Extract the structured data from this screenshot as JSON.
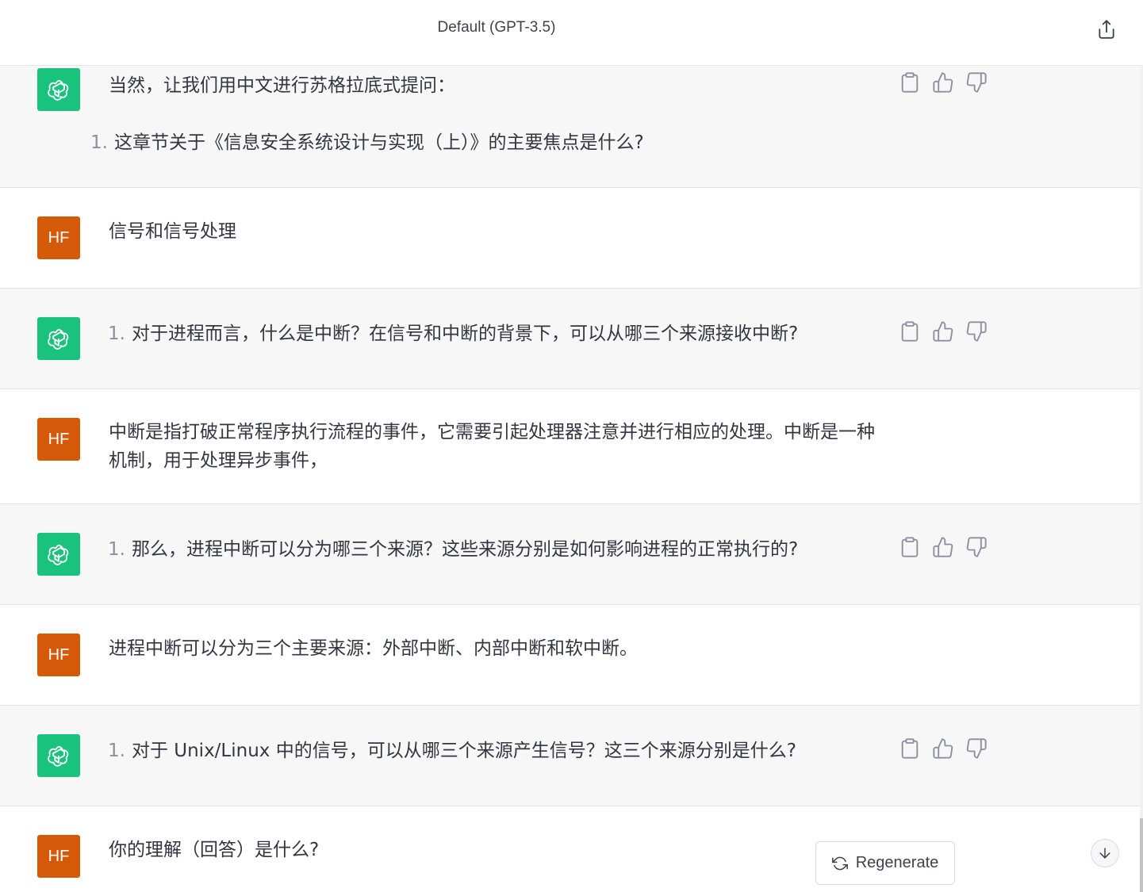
{
  "header": {
    "title": "Default (GPT-3.5)",
    "share_icon": "share-icon"
  },
  "messages": [
    {
      "role": "assistant",
      "avatar_icon": "openai-logo-icon",
      "intro": "当然，让我们用中文进行苏格拉底式提问：",
      "list": [
        {
          "num": "1.",
          "text": "这章节关于《信息安全系统设计与实现（上）》的主要焦点是什么?"
        }
      ]
    },
    {
      "role": "user",
      "avatar_label": "HF",
      "text": "信号和信号处理"
    },
    {
      "role": "assistant",
      "avatar_icon": "openai-logo-icon",
      "list": [
        {
          "num": "1.",
          "text": "对于进程而言，什么是中断？在信号和中断的背景下，可以从哪三个来源接收中断?"
        }
      ]
    },
    {
      "role": "user",
      "avatar_label": "HF",
      "text": "中断是指打破正常程序执行流程的事件，它需要引起处理器注意并进行相应的处理。中断是一种机制，用于处理异步事件，"
    },
    {
      "role": "assistant",
      "avatar_icon": "openai-logo-icon",
      "list": [
        {
          "num": "1.",
          "text": "那么，进程中断可以分为哪三个来源？这些来源分别是如何影响进程的正常执行的?"
        }
      ]
    },
    {
      "role": "user",
      "avatar_label": "HF",
      "text": "进程中断可以分为三个主要来源：外部中断、内部中断和软中断。"
    },
    {
      "role": "assistant",
      "avatar_icon": "openai-logo-icon",
      "list": [
        {
          "num": "1.",
          "text": "对于 Unix/Linux 中的信号，可以从哪三个来源产生信号？这三个来源分别是什么?"
        }
      ]
    },
    {
      "role": "user",
      "avatar_label": "HF",
      "text": "你的理解（回答）是什么?"
    }
  ],
  "message_actions": [
    "clipboard-icon",
    "thumbs-up-icon",
    "thumbs-down-icon"
  ],
  "regenerate": {
    "label": "Regenerate",
    "icon": "refresh-icon"
  },
  "scroll_down_icon": "arrow-down-icon",
  "colors": {
    "assistant_avatar": "#19c37d",
    "user_avatar": "#d45909",
    "assistant_bg": "#f7f7f8"
  }
}
